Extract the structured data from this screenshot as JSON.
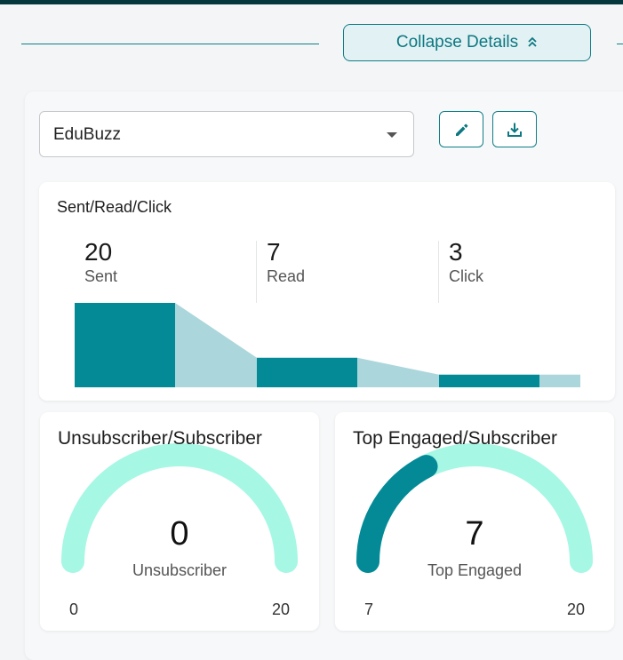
{
  "header": {
    "collapse_label": "Collapse Details",
    "collapse_icon": "double-chevron-up-icon"
  },
  "toolbar": {
    "campaign_selected": "EduBuzz",
    "edit_icon": "pencil-icon",
    "download_icon": "download-icon"
  },
  "funnel": {
    "title": "Sent/Read/Click",
    "stats": [
      {
        "value": "20",
        "label": "Sent"
      },
      {
        "value": "7",
        "label": "Read"
      },
      {
        "value": "3",
        "label": "Click"
      }
    ]
  },
  "gauges": [
    {
      "title": "Unsubscriber/Subscriber",
      "value": "0",
      "label": "Unsubscriber",
      "min": "0",
      "max": "20",
      "fraction": 0
    },
    {
      "title": "Top Engaged/Subscriber",
      "value": "7",
      "label": "Top Engaged",
      "min": "7",
      "max": "20",
      "fraction": 0.35
    }
  ],
  "chart_data": {
    "type": "bar",
    "categories": [
      "Sent",
      "Read",
      "Click"
    ],
    "values": [
      20,
      7,
      3
    ],
    "title": "Sent/Read/Click",
    "ylim": [
      0,
      20
    ]
  },
  "colors": {
    "accent": "#0f7e86",
    "bar": "#048a96",
    "connector": "#abd6dc",
    "gauge_track": "#a6f7e4",
    "gauge_fill": "#048a96"
  }
}
